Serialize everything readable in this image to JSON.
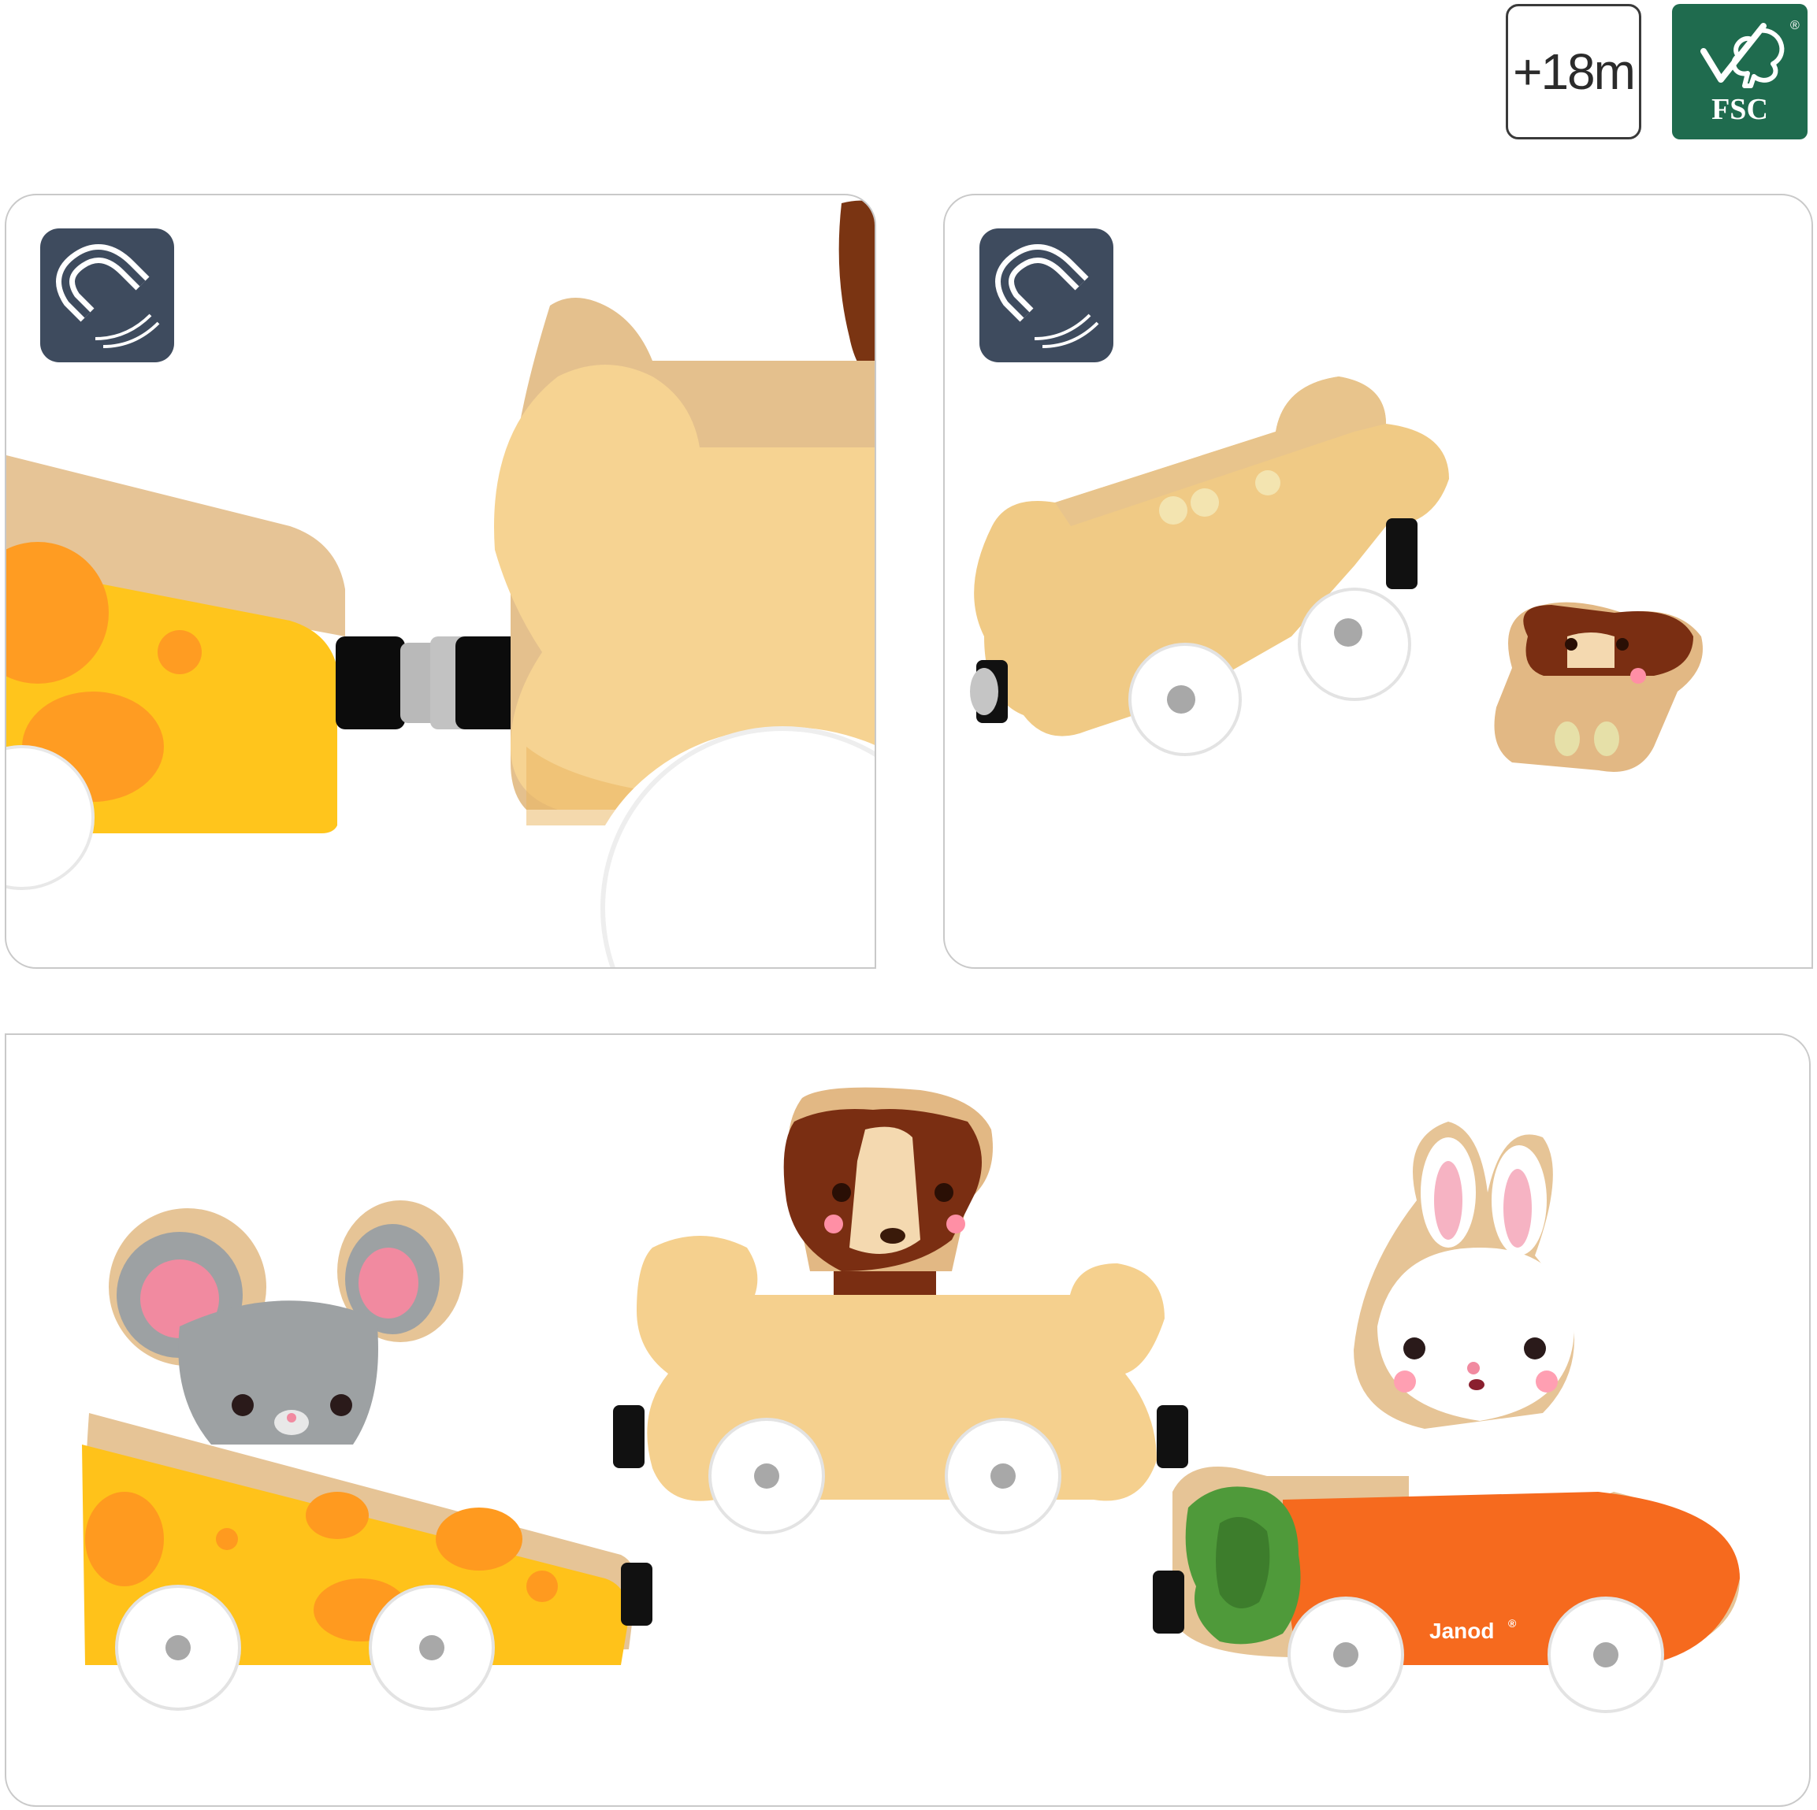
{
  "badges": {
    "age": "+18m",
    "fsc": "FSC",
    "fsc_mark": "®"
  },
  "icons": [
    "magnet-icon",
    "magnet-icon"
  ],
  "brand": {
    "name": "Janod",
    "mark": "®"
  },
  "colors": {
    "cheese": "#ffc21a",
    "cheese_hole": "#ff9a1f",
    "bone": "#f7d79a",
    "wood": "#e8c89a",
    "carrot": "#f66a1e",
    "leaves": "#4f9a3a",
    "mouse": "#9aa0a3",
    "dog_brown": "#8a3d1f",
    "magnet_badge": "#3e4b5e",
    "fsc_green": "#1f6b4e"
  }
}
